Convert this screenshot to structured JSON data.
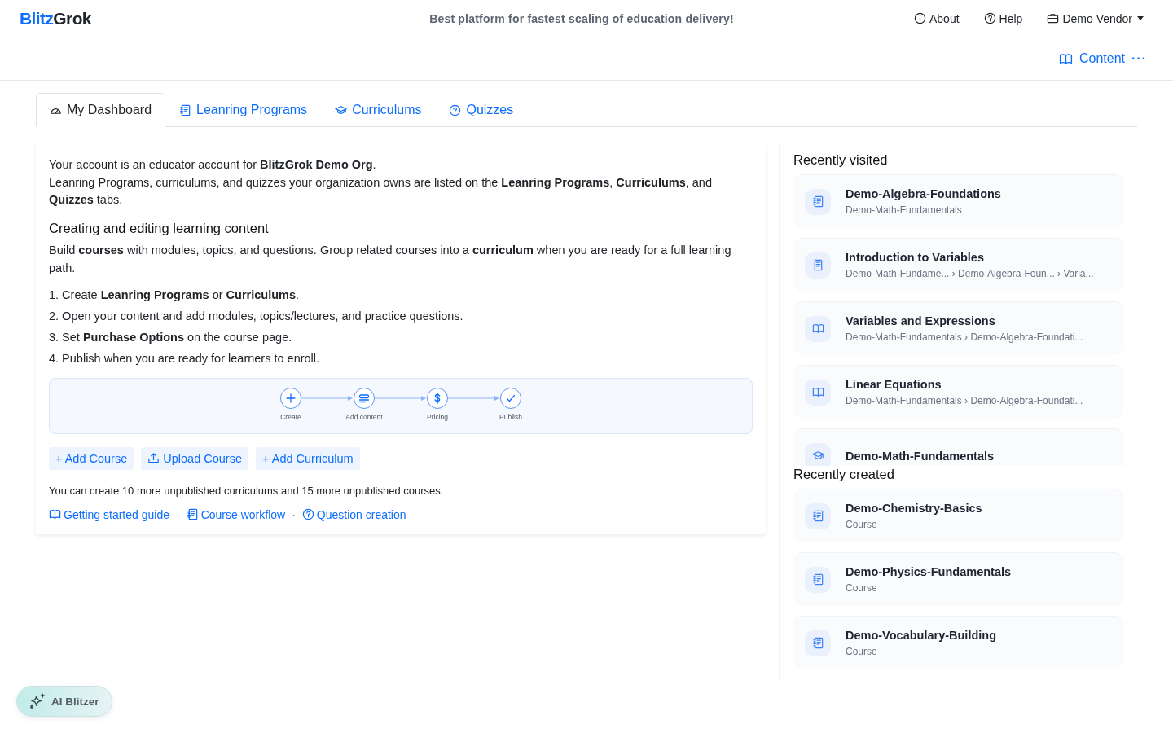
{
  "header": {
    "logo": {
      "accent": "Blitz",
      "rest": "Grok"
    },
    "tagline": "Best platform for fastest scaling of education delivery!",
    "links": [
      {
        "kind": "info",
        "label": "About"
      },
      {
        "kind": "help",
        "label": "Help"
      },
      {
        "kind": "vendor",
        "label": "Demo Vendor",
        "dropdown": true
      }
    ]
  },
  "subbar": {
    "label": "Content",
    "more": "···"
  },
  "tabs": [
    {
      "kind": "dashboard",
      "label": "My Dashboard",
      "selected": true
    },
    {
      "kind": "course",
      "label": "Leanring Programs",
      "selected": false
    },
    {
      "kind": "curriculum",
      "label": "Curriculums",
      "selected": false
    },
    {
      "kind": "quiz",
      "label": "Quizzes",
      "selected": false
    }
  ],
  "intro": [
    "Your account is an educator account for **BlitzGrok Demo Org**.",
    "Leanring Programs, curriculums, and quizzes your organization owns are listed on the **Leanring Programs**, **Curriculums**, and **Quizzes** tabs."
  ],
  "section": {
    "heading": "Creating and editing learning content",
    "text": "Build **courses** with modules, topics, and questions. Group related courses into a **curriculum** when you are ready for a full learning path.",
    "steps": [
      "1. Create **Leanring Programs** or **Curriculums**.",
      "2. Open your content and add modules, topics/lectures, and practice questions.",
      "3. Set **Purchase Options** on the course page.",
      "4. Publish when you are ready for learners to enroll."
    ]
  },
  "workflow": [
    {
      "kind": "create",
      "label": "Create"
    },
    {
      "kind": "content",
      "label": "Add content"
    },
    {
      "kind": "pricing",
      "label": "Pricing"
    },
    {
      "kind": "publish",
      "label": "Publish"
    }
  ],
  "actions": [
    {
      "kind": "add",
      "label": "+ Add Course"
    },
    {
      "kind": "upload",
      "label": "Upload Course"
    },
    {
      "kind": "add",
      "label": "+ Add Curriculum"
    }
  ],
  "limit_note": "You can create 10 more unpublished curriculums and 15 more unpublished courses.",
  "guides": {
    "separator": "·",
    "links": [
      {
        "kind": "book",
        "label": "Getting started guide"
      },
      {
        "kind": "course",
        "label": "Course workflow"
      },
      {
        "kind": "quiz",
        "label": "Question creation"
      }
    ]
  },
  "recently_visited": {
    "title": "Recently visited",
    "items": [
      {
        "kind": "course",
        "title": "Demo-Algebra-Foundations",
        "subtitle": "Demo-Math-Fundamentals"
      },
      {
        "kind": "lecture",
        "title": "Introduction to Variables",
        "subtitle": "Demo-Math-Fundame... › Demo-Algebra-Foun... › Varia..."
      },
      {
        "kind": "book",
        "title": "Variables and Expressions",
        "subtitle": "Demo-Math-Fundamentals › Demo-Algebra-Foundati..."
      },
      {
        "kind": "book",
        "title": "Linear Equations",
        "subtitle": "Demo-Math-Fundamentals › Demo-Algebra-Foundati..."
      },
      {
        "kind": "curriculum",
        "title": "Demo-Math-Fundamentals"
      }
    ]
  },
  "recently_created": {
    "title": "Recently created",
    "items": [
      {
        "kind": "course",
        "title": "Demo-Chemistry-Basics",
        "subtitle": "Course"
      },
      {
        "kind": "course",
        "title": "Demo-Physics-Fundamentals",
        "subtitle": "Course"
      },
      {
        "kind": "course",
        "title": "Demo-Vocabulary-Building",
        "subtitle": "Course"
      }
    ]
  },
  "assistant": {
    "label": "AI Blitzer"
  }
}
